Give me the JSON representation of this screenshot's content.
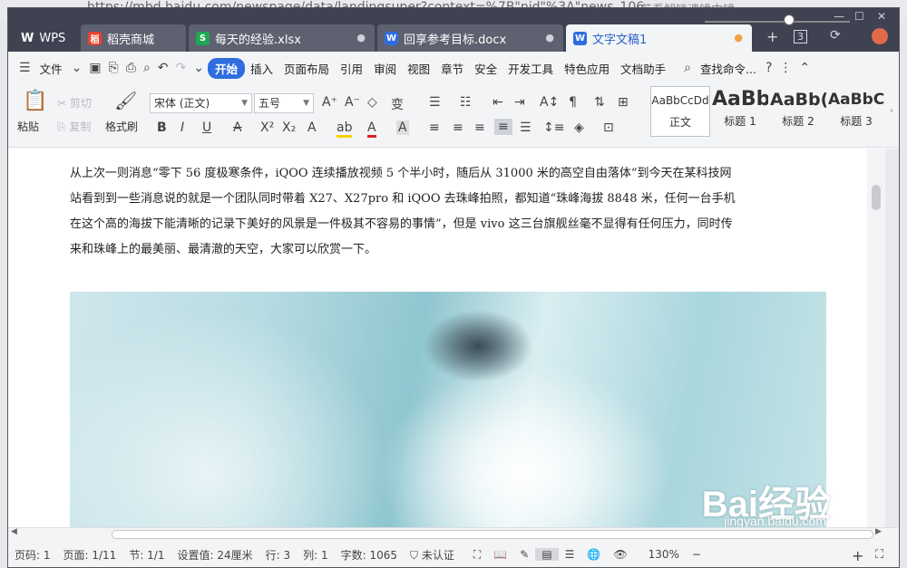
{
  "background": {
    "url_text": "https://mbd.baidu.com/newspage/data/landingsuper?context=%7B\"nid\"%3A\"news_106",
    "right_text": "若看解锁课镜中镜"
  },
  "window": {
    "controls": {
      "minimize": "—",
      "maximize": "☐",
      "close": "✕"
    }
  },
  "tabs": [
    {
      "label": "WPS",
      "icon": "wps-logo",
      "color": "#ffffff"
    },
    {
      "label": "稻壳商城",
      "icon": "docer-icon",
      "color": "#e8412c"
    },
    {
      "label": "每天的经验.xlsx",
      "icon": "spreadsheet-icon",
      "color": "#1fa854"
    },
    {
      "label": "回享参考目标.docx",
      "icon": "writer-icon",
      "color": "#2f6de0"
    },
    {
      "label": "文字文稿1",
      "icon": "writer-icon",
      "color": "#2f6de0"
    }
  ],
  "tab_count": "3",
  "menu": {
    "file": "文件",
    "items": [
      "开始",
      "插入",
      "页面布局",
      "引用",
      "审阅",
      "视图",
      "章节",
      "安全",
      "开发工具",
      "特色应用",
      "文档助手"
    ],
    "active": "开始",
    "search": "查找命令..."
  },
  "ribbon": {
    "paste": "粘贴",
    "cut": "剪切",
    "copy": "复制",
    "format_painter": "格式刷",
    "font_name": "宋体 (正文)",
    "font_size": "五号",
    "styles": [
      {
        "preview": "AaBbCcDd",
        "caption": "正文"
      },
      {
        "preview": "AaBb",
        "caption": "标题 1"
      },
      {
        "preview": "AaBb(",
        "caption": "标题 2"
      },
      {
        "preview": "AaBbC",
        "caption": "标题 3"
      }
    ]
  },
  "document": {
    "paragraph": "从上次一则消息“零下 56 度极寒条件，iQOO 连续播放视频 5 个半小时，随后从 31000 米的高空自由落体”到今天在某科技网站看到到一些消息说的就是一个团队同时带着 X27、X27pro 和 iQOO 去珠峰拍照，都知道“珠峰海拔 8848 米，任何一台手机在这个高的海拔下能清晰的记录下美好的风景是一件极其不容易的事情”，但是 vivo 这三台旗舰丝毫不显得有任何压力，同时传来和珠峰上的最美丽、最清澈的天空，大家可以欣赏一下。",
    "watermark": "Bai经验",
    "watermark_url": "jingyan.baidu.com"
  },
  "status": {
    "page_num": "页码: 1",
    "pages": "页面: 1/11",
    "section": "节: 1/1",
    "setting": "设置值: 24厘米",
    "row": "行: 3",
    "col": "列: 1",
    "words": "字数: 1065",
    "auth": "未认证",
    "zoom": "130%",
    "zoom_level": 0.58
  }
}
